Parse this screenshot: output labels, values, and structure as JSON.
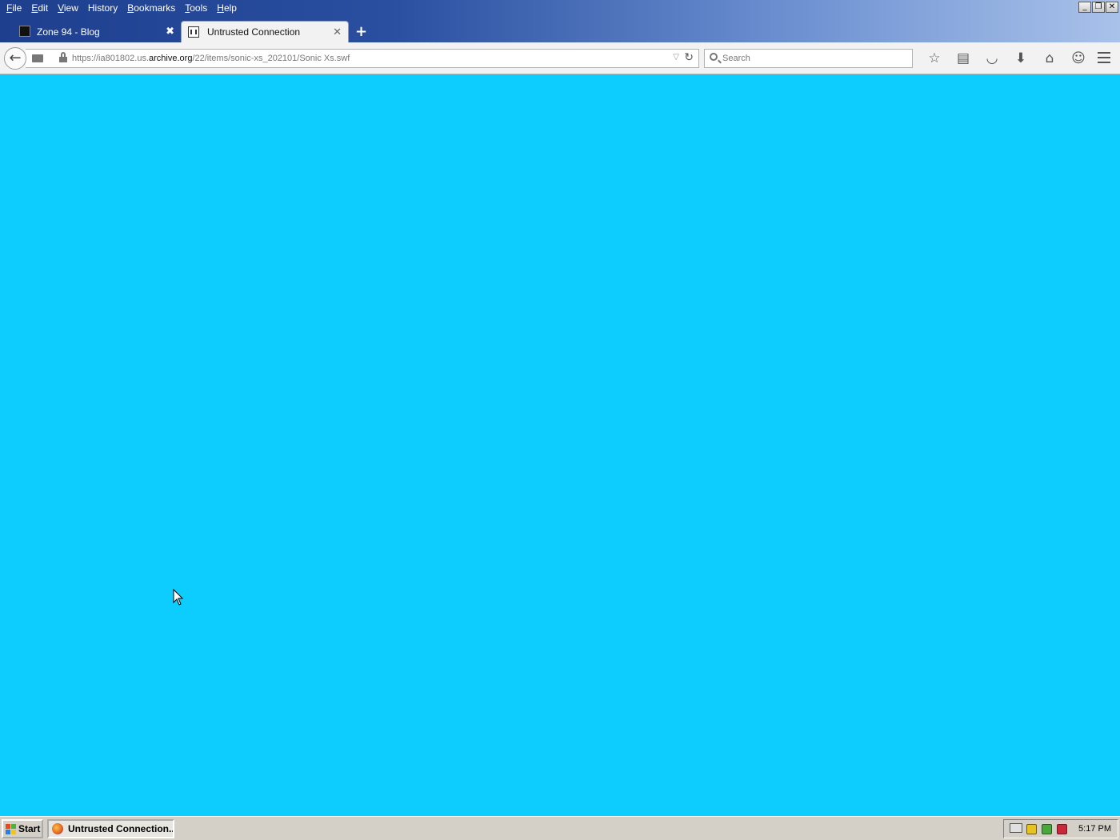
{
  "menubar": {
    "items": [
      {
        "accel": "F",
        "rest": "ile"
      },
      {
        "accel": "E",
        "rest": "dit"
      },
      {
        "accel": "V",
        "rest": "iew"
      },
      {
        "accel": "",
        "rest": "History"
      },
      {
        "accel": "B",
        "rest": "ookmarks"
      },
      {
        "accel": "T",
        "rest": "ools"
      },
      {
        "accel": "H",
        "rest": "elp"
      }
    ]
  },
  "window_controls": {
    "minimize": "_",
    "restore": "❐",
    "close": "✕"
  },
  "tabs": [
    {
      "label": "Zone 94 - Blog",
      "close": "✖"
    },
    {
      "label": "Untrusted Connection",
      "close": "✕"
    }
  ],
  "new_tab": "+",
  "navbar": {
    "back": "←",
    "url_prefix": "https://ia801802.us.",
    "url_host": "archive.org",
    "url_path": "/22/items/sonic-xs_202101/Sonic Xs.swf",
    "dropdown": "▽",
    "reload": "↻",
    "search_placeholder": "Search"
  },
  "toolbar_icons": [
    "star-icon",
    "reading-list-icon",
    "pocket-icon",
    "download-icon",
    "home-icon",
    "chat-icon",
    "hamburger-menu-icon"
  ],
  "toolbar_glyphs": {
    "bookmark": "☆",
    "reading": "▤",
    "pocket": "◡",
    "download": "⬇",
    "home": "⌂",
    "chat": "☺"
  },
  "content": {
    "background": "#0ccdfe"
  },
  "taskbar": {
    "start": "Start",
    "task": "Untrusted Connection...",
    "clock": "5:17 PM"
  }
}
